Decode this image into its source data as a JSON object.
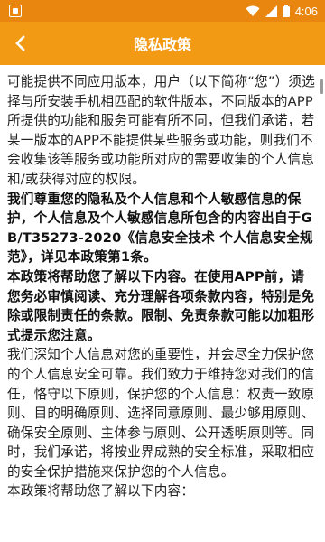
{
  "status_bar": {
    "time": "4:06",
    "icons": [
      "app-notification-icon",
      "wifi-icon",
      "signal-icon",
      "battery-icon"
    ]
  },
  "header": {
    "title": "隐私政策",
    "back_icon": "chevron-left-icon"
  },
  "colors": {
    "status_bar": "#e8860f",
    "title_bar": "#f39a14",
    "text": "#222222"
  },
  "content": {
    "paragraphs": [
      {
        "text": "可能提供不同应用版本，用户（以下简称“您”）须选择与所安装手机相匹配的软件版本，不同版本的APP所提供的功能和服务可能有所不同，但我们承诺，若某一版本的APP不能提供某些服务或功能，则我们不会收集该等服务或功能所对应的需要收集的个人信息和/或获得对应的权限。",
        "bold": false
      },
      {
        "text": "我们尊重您的隐私及个人信息和个人敏感信息的保护，个人信息及个人敏感信息所包含的内容出自于GB/T35273-2020《信息安全技术 个人信息安全规范》，详见本政策第1条。",
        "bold": true
      },
      {
        "text": "本政策将帮助您了解以下内容。在使用APP前，请您务必审慎阅读、充分理解各项条款内容，特别是免除或限制责任的条款。限制、免责条款可能以加粗形式提示您注意。",
        "bold": true
      },
      {
        "text": "我们深知个人信息对您的重要性，并会尽全力保护您的个人信息安全可靠。我们致力于维持您对我们的信任，恪守以下原则，保护您的个人信息：权责一致原则、目的明确原则、选择同意原则、最少够用原则、确保安全原则、主体参与原则、公开透明原则等。同时，我们承诺，将按业界成熟的安全标准，采取相应的安全保护措施来保护您的个人信息。",
        "bold": false
      },
      {
        "text": "本政策将帮助您了解以下内容：",
        "bold": false
      }
    ]
  }
}
